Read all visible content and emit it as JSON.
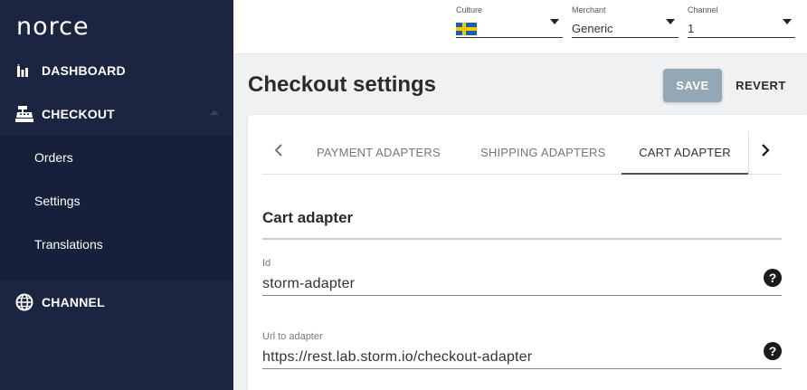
{
  "app": {
    "logo_text": "norce"
  },
  "sidebar": {
    "dashboard": {
      "label": "DASHBOARD",
      "icon": "bar-chart-icon"
    },
    "checkout": {
      "label": "CHECKOUT",
      "icon": "cash-register-icon"
    },
    "checkout_sub": [
      {
        "label": "Orders"
      },
      {
        "label": "Settings"
      },
      {
        "label": "Translations"
      }
    ],
    "channel": {
      "label": "CHANNEL",
      "icon": "globe-icon"
    }
  },
  "topbar": {
    "culture": {
      "caption": "Culture",
      "value_icon": "swedish-flag-icon"
    },
    "merchant": {
      "caption": "Merchant",
      "value": "Generic"
    },
    "channel": {
      "caption": "Channel",
      "value": "1"
    }
  },
  "main": {
    "title": "Checkout settings",
    "save_label": "SAVE",
    "revert_label": "REVERT",
    "tabs": [
      {
        "label": "PAYMENT ADAPTERS",
        "active": false
      },
      {
        "label": "SHIPPING ADAPTERS",
        "active": false
      },
      {
        "label": "CART ADAPTER",
        "active": true
      }
    ],
    "section_title": "Cart adapter",
    "fields": {
      "id": {
        "label": "Id",
        "value": "storm-adapter",
        "help": "?"
      },
      "url": {
        "label": "Url to adapter",
        "value": "https://rest.lab.storm.io/checkout-adapter",
        "help": "?"
      }
    }
  },
  "colors": {
    "sidebar_bg": "#1b2440",
    "submenu_bg": "#16203a",
    "save_button_bg": "#93a8b4",
    "flag_blue": "#1f5fa8",
    "flag_yellow": "#f7c700"
  }
}
